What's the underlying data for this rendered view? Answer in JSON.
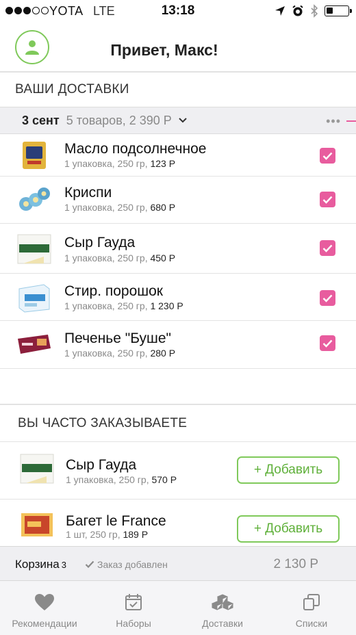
{
  "status_bar": {
    "carrier": "YOTA",
    "network": "LTE",
    "time": "13:18",
    "battery_level": 0.3
  },
  "header": {
    "greeting": "Привет, Макс!"
  },
  "deliveries": {
    "section_title": "ВАШИ ДОСТАВКИ",
    "date": "3 сент",
    "summary": "5 товаров, 2 390 Р",
    "more": "•••",
    "items": [
      {
        "name": "Масло подсолнечное",
        "meta": "1 упаковка, 250 гр,",
        "price": "123 Р"
      },
      {
        "name": "Криспи",
        "meta": "1 упаковка, 250 гр,",
        "price": "680 Р"
      },
      {
        "name": "Сыр Гауда",
        "meta": "1 упаковка, 250 гр,",
        "price": "450 Р"
      },
      {
        "name": "Стир. порошок",
        "meta": "1 упаковка, 250 гр,",
        "price": "1 230 Р"
      },
      {
        "name": "Печенье \"Буше\"",
        "meta": "1 упаковка, 250 гр,",
        "price": "280 Р"
      }
    ]
  },
  "frequent": {
    "section_title": "ВЫ ЧАСТО ЗАКАЗЫВАЕТЕ",
    "items": [
      {
        "name": "Сыр Гауда",
        "meta": "1 упаковка, 250 гр,",
        "price": "570 Р",
        "button": "+ Добавить"
      },
      {
        "name": "Багет le France",
        "meta": "1 шт, 250 гр,",
        "price": "189 Р",
        "button": "+ Добавить"
      }
    ]
  },
  "cart": {
    "label": "Корзина",
    "count": "3",
    "status": "Заказ добавлен",
    "total": "2 130  Р"
  },
  "tabs": [
    {
      "label": "Рекомендации",
      "icon": "heart-icon"
    },
    {
      "label": "Наборы",
      "icon": "calendar-icon"
    },
    {
      "label": "Доставки",
      "icon": "boxes-icon"
    },
    {
      "label": "Списки",
      "icon": "lists-icon"
    }
  ],
  "colors": {
    "accent_green": "#7fc95a",
    "accent_pink": "#e85c9e"
  }
}
